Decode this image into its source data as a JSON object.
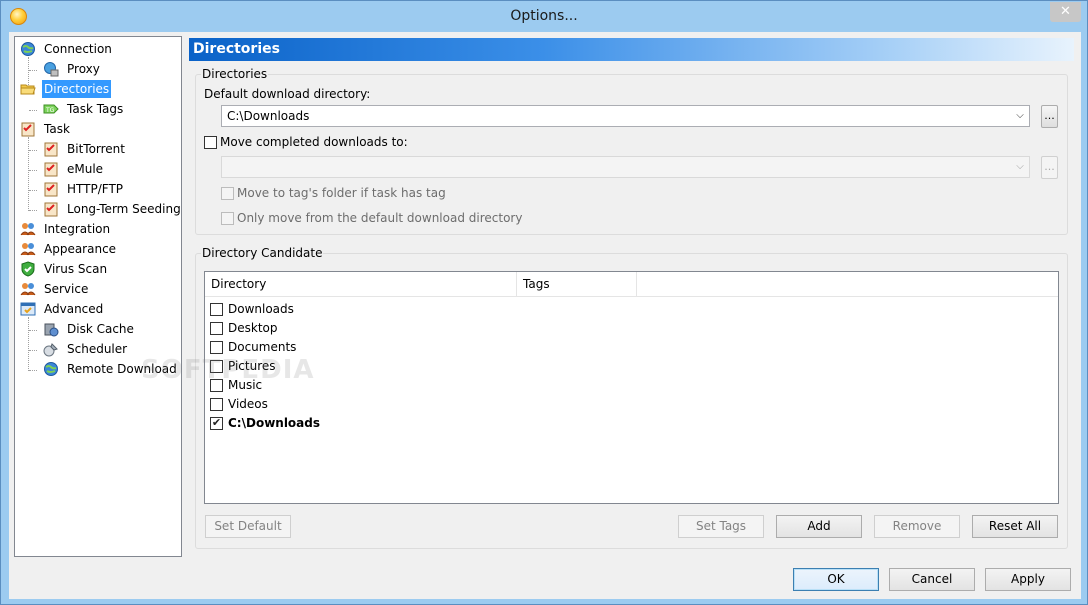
{
  "window": {
    "title": "Options...",
    "close_glyph": "✕"
  },
  "tree": {
    "items": [
      {
        "label": "Connection",
        "icon": "globe-icon"
      },
      {
        "label": "Proxy",
        "icon": "network-icon"
      },
      {
        "label": "Directories",
        "icon": "folder-icon",
        "selected": true
      },
      {
        "label": "Task Tags",
        "icon": "tag-icon"
      },
      {
        "label": "Task",
        "icon": "checklist-icon"
      },
      {
        "label": "BitTorrent",
        "icon": "checklist-icon"
      },
      {
        "label": "eMule",
        "icon": "checklist-icon"
      },
      {
        "label": "HTTP/FTP",
        "icon": "checklist-icon"
      },
      {
        "label": "Long-Term Seeding",
        "icon": "checklist-icon"
      },
      {
        "label": "Integration",
        "icon": "users-icon"
      },
      {
        "label": "Appearance",
        "icon": "users-icon"
      },
      {
        "label": "Virus Scan",
        "icon": "shield-icon"
      },
      {
        "label": "Service",
        "icon": "users-icon"
      },
      {
        "label": "Advanced",
        "icon": "advanced-icon"
      },
      {
        "label": "Disk Cache",
        "icon": "disk-icon"
      },
      {
        "label": "Scheduler",
        "icon": "scheduler-icon"
      },
      {
        "label": "Remote Download",
        "icon": "globe-icon"
      }
    ]
  },
  "panel": {
    "title": "Directories",
    "directories_group": "Directories",
    "default_dir_label": "Default download directory:",
    "default_dir_value": "C:\\Downloads",
    "browse_label": "...",
    "move_completed_label": "Move completed downloads to:",
    "move_completed_checked": false,
    "move_completed_value": "",
    "move_tag_folder_label": "Move to tag's folder if task has tag",
    "only_move_default_label": "Only move from the default download directory"
  },
  "candidate": {
    "group_title": "Directory Candidate",
    "columns": [
      "Directory",
      "Tags"
    ],
    "rows": [
      {
        "directory": "Downloads",
        "tags": "",
        "checked": false
      },
      {
        "directory": "Desktop",
        "tags": "",
        "checked": false
      },
      {
        "directory": "Documents",
        "tags": "",
        "checked": false
      },
      {
        "directory": "Pictures",
        "tags": "",
        "checked": false
      },
      {
        "directory": "Music",
        "tags": "",
        "checked": false
      },
      {
        "directory": "Videos",
        "tags": "",
        "checked": false
      },
      {
        "directory": "C:\\Downloads",
        "tags": "",
        "checked": true
      }
    ],
    "buttons": {
      "set_default": "Set Default",
      "set_tags": "Set Tags",
      "add": "Add",
      "remove": "Remove",
      "reset_all": "Reset All"
    }
  },
  "footer": {
    "ok": "OK",
    "cancel": "Cancel",
    "apply": "Apply"
  },
  "watermark": "SOFTPEDIA"
}
